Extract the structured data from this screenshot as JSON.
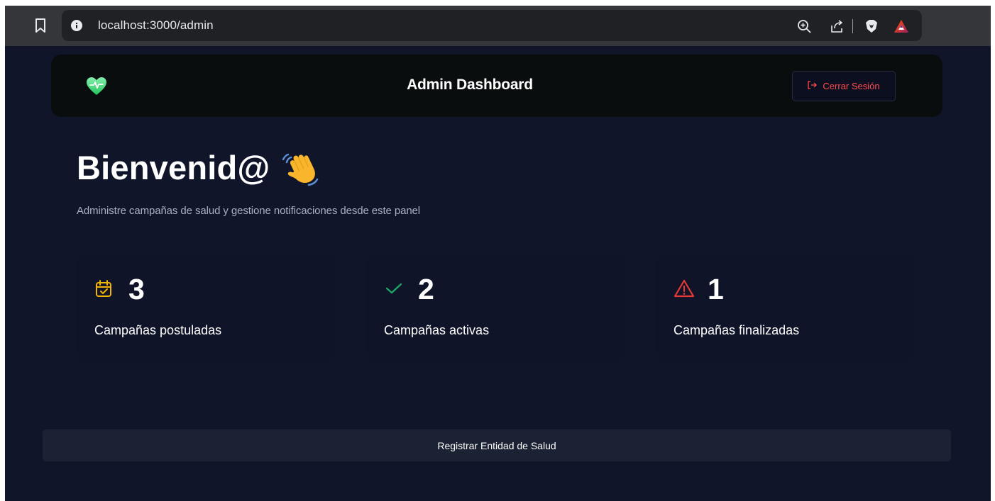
{
  "browser": {
    "url": "localhost:3000/admin"
  },
  "header": {
    "title": "Admin Dashboard",
    "logout_label": "Cerrar Sesión"
  },
  "welcome": {
    "title": "Bienvenid@",
    "subtitle": "Administre campañas de salud y gestione notificaciones desde este panel"
  },
  "stats": [
    {
      "value": "3",
      "label": "Campañas postuladas",
      "icon": "calendar-check-icon",
      "color": "#f4b400"
    },
    {
      "value": "2",
      "label": "Campañas activas",
      "icon": "check-icon",
      "color": "#1fa463"
    },
    {
      "value": "1",
      "label": "Campañas finalizadas",
      "icon": "warning-triangle-icon",
      "color": "#e53935"
    }
  ],
  "actions": {
    "register_label": "Registrar Entidad de Salud"
  },
  "colors": {
    "page_background": "#10152a",
    "header_background": "#090d0e",
    "logout_text": "#ff4d4f",
    "logo_green": "#4ade80"
  }
}
